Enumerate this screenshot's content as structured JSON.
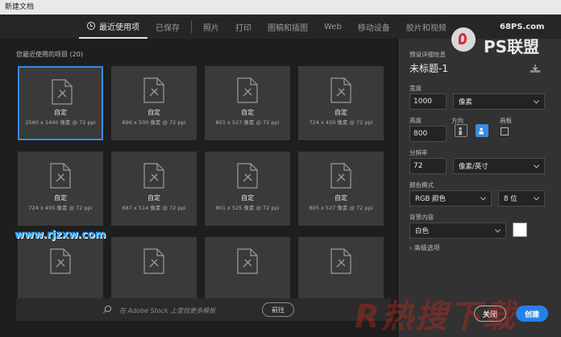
{
  "window": {
    "title": "新建文档"
  },
  "tabs": [
    {
      "label": "最近使用项",
      "active": true
    },
    {
      "label": "已保存",
      "active": false
    },
    {
      "label": "照片",
      "active": false
    },
    {
      "label": "打印",
      "active": false
    },
    {
      "label": "图稿和插图",
      "active": false
    },
    {
      "label": "Web",
      "active": false
    },
    {
      "label": "移动设备",
      "active": false
    },
    {
      "label": "胶片和视频",
      "active": false
    }
  ],
  "watermarks": {
    "site_small": "68PS.com",
    "brand": "PS联盟",
    "rjzxw": "www.rjzxw.com",
    "bottom": "R热搜下载"
  },
  "recent": {
    "title": "您最近使用的项目",
    "count": "(20)",
    "items": [
      {
        "name": "自定",
        "dims": "2560 x 1440 像素 @ 72 ppi",
        "selected": true
      },
      {
        "name": "自定",
        "dims": "696 x 500 像素 @ 72 ppi"
      },
      {
        "name": "自定",
        "dims": "801 x 527 像素 @ 72 ppi"
      },
      {
        "name": "自定",
        "dims": "724 x 450 像素 @ 72 ppi"
      },
      {
        "name": "自定",
        "dims": "724 x 495 像素 @ 72 ppi"
      },
      {
        "name": "自定",
        "dims": "687 x 514 像素 @ 72 ppi"
      },
      {
        "name": "自定",
        "dims": "801 x 525 像素 @ 72 ppi"
      },
      {
        "name": "自定",
        "dims": "805 x 527 像素 @ 72 ppi"
      },
      {
        "name": "",
        "dims": ""
      },
      {
        "name": "",
        "dims": ""
      },
      {
        "name": "",
        "dims": ""
      },
      {
        "name": "",
        "dims": ""
      }
    ]
  },
  "search": {
    "placeholder": "在 Adobe Stock 上查找更多模板",
    "go_label": "前往"
  },
  "preset": {
    "section_label": "预设详细信息",
    "doc_title": "未标题-1",
    "width_label": "宽度",
    "width_value": "1000",
    "width_unit": "像素",
    "height_label": "高度",
    "height_value": "800",
    "orientation_label": "方向",
    "artboard_label": "画板",
    "resolution_label": "分辨率",
    "resolution_value": "72",
    "resolution_unit": "像素/英寸",
    "color_mode_label": "颜色模式",
    "color_mode_value": "RGB 颜色",
    "bit_depth_value": "8 位",
    "background_label": "背景内容",
    "background_value": "白色",
    "background_color": "#ffffff",
    "advanced_label": "高级选项"
  },
  "actions": {
    "close_label": "关闭",
    "create_label": "创建"
  },
  "colors": {
    "accent": "#2680eb"
  }
}
